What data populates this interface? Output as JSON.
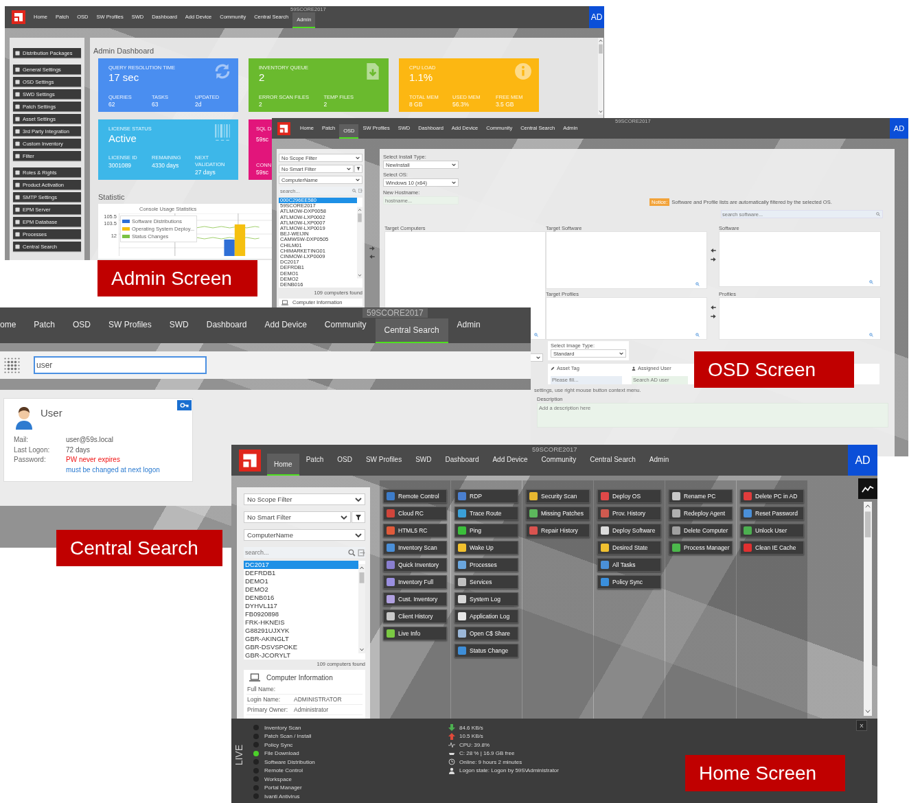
{
  "admin_screen": {
    "nav": {
      "server": "59SCORE2017",
      "user_badge": "AD",
      "tabs": [
        {
          "label": "Home",
          "selected": false
        },
        {
          "label": "Patch",
          "selected": false
        },
        {
          "label": "OSD",
          "selected": false
        },
        {
          "label": "SW Profiles",
          "selected": false
        },
        {
          "label": "SWD",
          "selected": false
        },
        {
          "label": "Dashboard",
          "selected": false
        },
        {
          "label": "Add Device",
          "selected": false
        },
        {
          "label": "Community",
          "selected": false
        },
        {
          "label": "Central Search",
          "selected": false
        },
        {
          "label": "Admin",
          "selected": true
        }
      ]
    },
    "sidebar": [
      {
        "items": [
          "Distribution Packages"
        ]
      },
      {
        "items": [
          "General Settings",
          "OSD Settings",
          "SWD Settings",
          "Patch Settings",
          "Asset Settings",
          "3rd Party Integration",
          "Custom Inventory",
          "Filter"
        ]
      },
      {
        "items": [
          "Roles & Rights",
          "Product Activation",
          "SMTP Settings",
          "EPM Server",
          "EPM Database",
          "Processes",
          "Central Search"
        ]
      }
    ],
    "title": "Admin Dashboard",
    "cards": [
      {
        "kind": "refresh",
        "color": "#4a8ef0",
        "heading": "QUERY RESOLUTION TIME",
        "value": "17 sec",
        "stats": [
          {
            "label": "QUERIES",
            "value": "62"
          },
          {
            "label": "TASKS",
            "value": "63"
          },
          {
            "label": "UPDATED",
            "value": "2d"
          }
        ]
      },
      {
        "kind": "download",
        "color": "#6aba2e",
        "heading": "INVENTORY QUEUE",
        "value": "2",
        "stats": [
          {
            "label": "ERROR SCAN FILES",
            "value": "2"
          },
          {
            "label": "TEMP FILES",
            "value": "2"
          }
        ]
      },
      {
        "kind": "info",
        "color": "#fcb712",
        "heading": "CPU LOAD",
        "value": "1.1%",
        "stats": [
          {
            "label": "TOTAL MEM",
            "value": "8 GB"
          },
          {
            "label": "USED MEM",
            "value": "56.3%"
          },
          {
            "label": "FREE MEM",
            "value": "3.5 GB"
          }
        ]
      },
      {
        "kind": "barcode",
        "color": "#3db7e9",
        "heading": "LICENSE STATUS",
        "value": "Active",
        "stats": [
          {
            "label": "LICENSE ID",
            "value": "3001089"
          },
          {
            "label": "REMAINING",
            "value": "4330 days"
          },
          {
            "label": "NEXT VALIDATION",
            "value": "27 days"
          }
        ]
      },
      {
        "kind": "text",
        "color": "#e2157b",
        "heading": "SQL D",
        "value": "59sc",
        "stats": [
          {
            "label": "CONN",
            "value": "59sc"
          }
        ]
      }
    ],
    "statistic": {
      "heading": "Statistic",
      "chart_title": "Console Usage Statistics",
      "y_ticks": [
        "105.5",
        "103.5",
        "12"
      ],
      "legend": [
        {
          "label": "Software Distributions",
          "color": "#2f6fd6"
        },
        {
          "label": "Operating System Deploy...",
          "color": "#f5c010"
        },
        {
          "label": "Status Changes",
          "color": "#7cc242"
        }
      ]
    }
  },
  "osd_screen": {
    "nav": {
      "server": "59SCORE2017",
      "user_badge": "AD",
      "tabs": [
        {
          "label": "Home",
          "selected": false
        },
        {
          "label": "Patch",
          "selected": false
        },
        {
          "label": "OSD",
          "selected": true
        },
        {
          "label": "SW Profiles",
          "selected": false
        },
        {
          "label": "SWD",
          "selected": false
        },
        {
          "label": "Dashboard",
          "selected": false
        },
        {
          "label": "Add Device",
          "selected": false
        },
        {
          "label": "Community",
          "selected": false
        },
        {
          "label": "Central Search",
          "selected": false
        },
        {
          "label": "Admin",
          "selected": false
        }
      ]
    },
    "scope_filter": "No Scope Filter",
    "smart_filter": "No Smart Filter",
    "sort_field": "ComputerName",
    "search_placeholder": "search...",
    "computers": [
      {
        "name": "000C296EE580",
        "selected": true
      },
      {
        "name": "59SCORE2017",
        "selected": false
      },
      {
        "name": "ATLMOW-DXP0058",
        "selected": false
      },
      {
        "name": "ATLMOW-LXP0002",
        "selected": false
      },
      {
        "name": "ATLMOW-LXP0007",
        "selected": false
      },
      {
        "name": "ATLMOW-LXP0019",
        "selected": false
      },
      {
        "name": "BEJ-WEIJIN",
        "selected": false
      },
      {
        "name": "CAMWSW-DXP0505",
        "selected": false
      },
      {
        "name": "CHILM01",
        "selected": false
      },
      {
        "name": "CHIMARKETING01",
        "selected": false
      },
      {
        "name": "CINMOW-LXP0009",
        "selected": false
      },
      {
        "name": "DC2017",
        "selected": false
      },
      {
        "name": "DEFRDB1",
        "selected": false
      },
      {
        "name": "DEMO1",
        "selected": false
      },
      {
        "name": "DEMO2",
        "selected": false
      },
      {
        "name": "DENB016",
        "selected": false
      }
    ],
    "computer_count": "109 computers found",
    "info_heading": "Computer Information",
    "install_type_label": "Select Install Type:",
    "install_type": "NewInstall",
    "os_label": "Select OS:",
    "os": "Windows 10 (x64)",
    "hostname_label": "New Hostname:",
    "hostname_placeholder": "hostname...",
    "notice_badge": "Notice:",
    "notice": "Software and Profile lists are automatically filtered by the selected OS.",
    "software_search_placeholder": "search software...",
    "target_computers_label": "Target Computers",
    "target_software_label": "Target Software",
    "target_profiles_label": "Target Profiles",
    "software_label": "Software",
    "profiles_label": "Profiles",
    "image_type_label": "Select Image Type:",
    "image_type": "Standard",
    "asset_tag_label": "Asset Tag",
    "asset_tag_placeholder": "Please fill...",
    "assigned_user_label": "Assigned User",
    "assigned_user_placeholder": "Search AD user",
    "context_hint": "settings, use right mouse button context menu.",
    "description_label": "Description",
    "description_placeholder": "Add a description here"
  },
  "central_search_screen": {
    "nav": {
      "server": "59SCORE2017",
      "tabs": [
        {
          "label": "ome",
          "selected": false
        },
        {
          "label": "Patch",
          "selected": false
        },
        {
          "label": "OSD",
          "selected": false
        },
        {
          "label": "SW Profiles",
          "selected": false
        },
        {
          "label": "SWD",
          "selected": false
        },
        {
          "label": "Dashboard",
          "selected": false
        },
        {
          "label": "Add Device",
          "selected": false
        },
        {
          "label": "Community",
          "selected": false
        },
        {
          "label": "Central Search",
          "selected": true
        },
        {
          "label": "Admin",
          "selected": false
        }
      ]
    },
    "query": "user",
    "result": {
      "name": "User",
      "fields": [
        {
          "kind": "plain",
          "label": "Mail:",
          "value": "user@59s.local"
        },
        {
          "kind": "plain",
          "label": "Last Logon:",
          "value": "72 days"
        },
        {
          "kind": "warning",
          "label": "Password:",
          "value": "PW never expires"
        },
        {
          "kind": "note",
          "value": "must be changed at next logon"
        }
      ]
    }
  },
  "home_screen": {
    "nav": {
      "server": "59SCORE2017",
      "user_badge": "AD",
      "tabs": [
        {
          "label": "Home",
          "selected": true
        },
        {
          "label": "Patch",
          "selected": false
        },
        {
          "label": "OSD",
          "selected": false
        },
        {
          "label": "SW Profiles",
          "selected": false
        },
        {
          "label": "SWD",
          "selected": false
        },
        {
          "label": "Dashboard",
          "selected": false
        },
        {
          "label": "Add Device",
          "selected": false
        },
        {
          "label": "Community",
          "selected": false
        },
        {
          "label": "Central Search",
          "selected": false
        },
        {
          "label": "Admin",
          "selected": false
        }
      ]
    },
    "scope_filter": "No Scope Filter",
    "smart_filter": "No Smart Filter",
    "sort_field": "ComputerName",
    "search_placeholder": "search...",
    "computers": [
      {
        "name": "DC2017",
        "selected": true
      },
      {
        "name": "DEFRDB1",
        "selected": false
      },
      {
        "name": "DEMO1",
        "selected": false
      },
      {
        "name": "DEMO2",
        "selected": false
      },
      {
        "name": "DENB016",
        "selected": false
      },
      {
        "name": "DYHVL117",
        "selected": false
      },
      {
        "name": "FB0920898",
        "selected": false
      },
      {
        "name": "FRK-HKNEIS",
        "selected": false
      },
      {
        "name": "G88291UJXYK",
        "selected": false
      },
      {
        "name": "GBR-AKINGLT",
        "selected": false
      },
      {
        "name": "GBR-DSVSPOKE",
        "selected": false
      },
      {
        "name": "GBR-JCORYLT",
        "selected": false
      }
    ],
    "computer_count": "109 computers found",
    "info_heading": "Computer Information",
    "info_fields": [
      {
        "label": "Full Name:"
      },
      {
        "label": "Login Name:",
        "value": "ADMINISTRATOR"
      },
      {
        "label": "Primary Owner:",
        "value": "Administrator"
      }
    ],
    "action_columns": [
      {
        "buttons": [
          {
            "label": "Remote Control",
            "color": "#3d7cc9"
          },
          {
            "label": "Cloud RC",
            "color": "#d0453b"
          },
          {
            "label": "HTML5 RC",
            "color": "#e05a3a"
          },
          {
            "label": "Inventory Scan",
            "color": "#4a8fd8"
          },
          {
            "label": "Quick Inventory",
            "color": "#8a7fd0"
          },
          {
            "label": "Inventory Full",
            "color": "#9a8fe0"
          },
          {
            "label": "Cust. Inventory",
            "color": "#b0a0e0"
          },
          {
            "label": "Client History",
            "color": "#c8c8c8"
          },
          {
            "label": "Live Info",
            "color": "#7ac943"
          }
        ]
      },
      {
        "buttons": [
          {
            "label": "RDP",
            "color": "#4a7fd0"
          },
          {
            "label": "Trace Route",
            "color": "#3aa0d8"
          },
          {
            "label": "Ping",
            "color": "#3bbf3b"
          },
          {
            "label": "Wake Up",
            "color": "#f2c12e"
          },
          {
            "label": "Processes",
            "color": "#6aa6de"
          },
          {
            "label": "Services",
            "color": "#c0c0c0"
          },
          {
            "label": "System Log",
            "color": "#d8d8d8"
          },
          {
            "label": "Application Log",
            "color": "#e6e6e6"
          },
          {
            "label": "Open C$ Share",
            "color": "#9bb7d8"
          },
          {
            "label": "Status Change",
            "color": "#3e8ed8"
          }
        ]
      },
      {
        "buttons": [
          {
            "label": "Security Scan",
            "color": "#e8b830"
          },
          {
            "label": "Missing Patches",
            "color": "#5cb85c"
          },
          {
            "label": "Repair History",
            "color": "#d9534f"
          }
        ]
      },
      {
        "buttons": [
          {
            "label": "Deploy OS",
            "color": "#e04848"
          },
          {
            "label": "Prov. History",
            "color": "#d05a4f"
          },
          {
            "label": "Deploy Software",
            "color": "#dcdcdc"
          },
          {
            "label": "Desired State",
            "color": "#f0c030"
          },
          {
            "label": "All Tasks",
            "color": "#4a90d8"
          },
          {
            "label": "Policy Sync",
            "color": "#3a8fdc"
          }
        ]
      },
      {
        "buttons": [
          {
            "label": "Rename PC",
            "color": "#c8c8c8"
          },
          {
            "label": "Redeploy Agent",
            "color": "#b0b0b0"
          },
          {
            "label": "Delete Computer",
            "color": "#a0a0a0"
          },
          {
            "label": "Process Manager",
            "color": "#4cb84c"
          }
        ]
      },
      {
        "buttons": [
          {
            "label": "Delete PC in AD",
            "color": "#e03c3c"
          },
          {
            "label": "Reset Password",
            "color": "#4a8fd8"
          },
          {
            "label": "Unlock User",
            "color": "#4caf50"
          },
          {
            "label": "Clean IE Cache",
            "color": "#e03030"
          }
        ]
      }
    ],
    "live": {
      "title": "LIVE",
      "close": "X",
      "tasks": [
        {
          "label": "Inventory Scan",
          "on": false
        },
        {
          "label": "Patch Scan / Install",
          "on": false
        },
        {
          "label": "Policy Sync",
          "on": false
        },
        {
          "label": "File Download",
          "on": true
        },
        {
          "label": "Software Distribution",
          "on": false
        },
        {
          "label": "Remote Control",
          "on": false
        },
        {
          "label": "Workspace",
          "on": false
        },
        {
          "label": "Portal Manager",
          "on": false
        },
        {
          "label": "Ivanti Antivirus",
          "on": false
        }
      ],
      "stats": [
        {
          "kind": "download",
          "text": "84.6 KB/s"
        },
        {
          "kind": "upload",
          "text": "10.5 KB/s"
        },
        {
          "kind": "cpu",
          "text": "CPU: 39.8%"
        },
        {
          "kind": "disk",
          "text": "C: 28 % | 16.9 GB free"
        },
        {
          "kind": "online",
          "text": "Online: 9 hours 2 minutes"
        },
        {
          "kind": "logon",
          "text": "Logon state: Logon by 59S\\Administrator"
        }
      ]
    }
  },
  "captions": [
    {
      "text": "Admin Screen"
    },
    {
      "text": "OSD Screen"
    },
    {
      "text": "Central Search"
    },
    {
      "text": "Home Screen"
    }
  ]
}
